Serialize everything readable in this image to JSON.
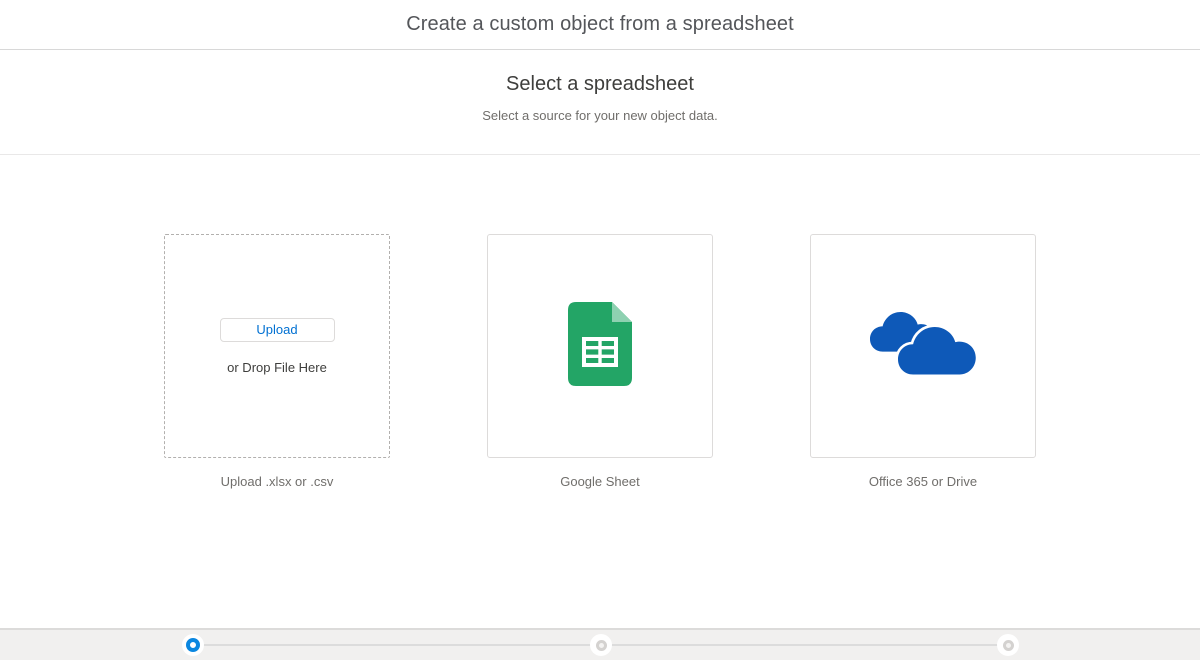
{
  "header": {
    "title": "Create a custom object from a spreadsheet"
  },
  "section": {
    "title": "Select a spreadsheet",
    "subtitle": "Select a source for your new object data."
  },
  "cards": {
    "upload": {
      "button_label": "Upload",
      "drop_text": "or Drop File Here",
      "caption": "Upload .xlsx or .csv"
    },
    "google": {
      "icon": "google-sheets-icon",
      "caption": "Google Sheet"
    },
    "office": {
      "icon": "onedrive-icon",
      "caption": "Office 365 or Drive"
    }
  },
  "progress": {
    "steps": [
      {
        "state": "active"
      },
      {
        "state": "inactive"
      },
      {
        "state": "inactive"
      }
    ]
  },
  "colors": {
    "accent_blue": "#0070d2",
    "active_step_blue": "#0b87e0",
    "sheets_green": "#23A566",
    "sheets_fold_green": "#8ED1B1",
    "onedrive_blue": "#0e59b8",
    "footer_gray": "#f1f0ef"
  }
}
